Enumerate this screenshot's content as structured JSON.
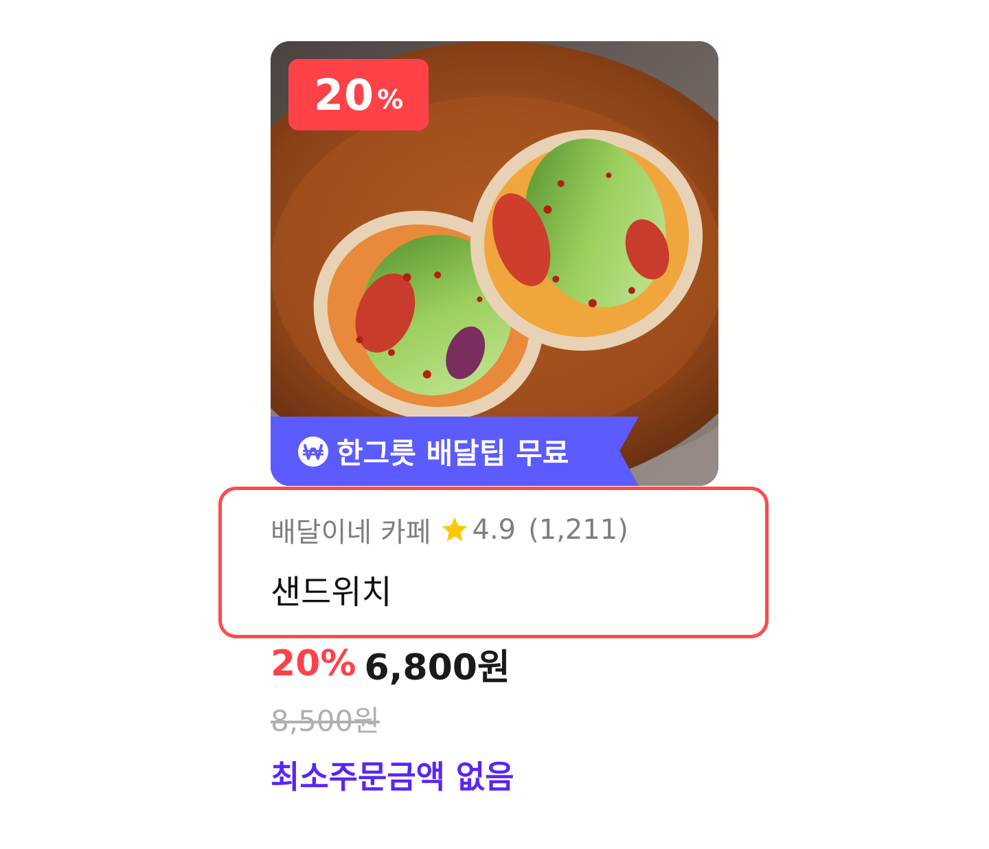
{
  "product": {
    "discount_badge": {
      "number": "20",
      "percent_sign": "%"
    },
    "delivery_ribbon": {
      "icon": "won-coin-icon",
      "label": "한그릇 배달팁 무료",
      "color": "#5b5bff"
    },
    "store": {
      "name": "배달이네 카페",
      "rating_icon": "star-icon",
      "rating": "4.9",
      "review_count": "(1,211)"
    },
    "name": "샌드위치",
    "price": {
      "discount_rate": "20%",
      "final_price": "6,800원",
      "original_price": "8,500원"
    },
    "min_order": "최소주문금액 없음"
  },
  "colors": {
    "discount_red": "#ff4148",
    "highlight_border": "#ff4a4a",
    "min_order_purple": "#5a25f5",
    "ribbon_blue": "#5b5bff",
    "star_yellow": "#ffc800"
  }
}
